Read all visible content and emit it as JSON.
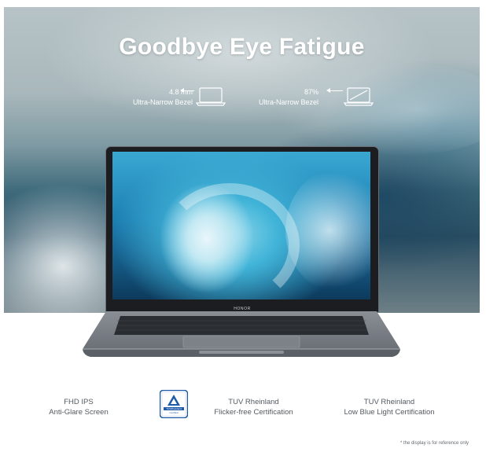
{
  "banner": {
    "title": "Goodbye Eye Fatigue",
    "specs": [
      {
        "value": "4.8 mm",
        "label": "Ultra-Narrow Bezel"
      },
      {
        "value": "87%",
        "label": "Ultra-Narrow Bezel"
      }
    ]
  },
  "laptop": {
    "brand": "HONOR"
  },
  "features": [
    {
      "line1": "FHD IPS",
      "line2": "Anti-Glare Screen"
    },
    {
      "line1": "TUV Rheinland",
      "line2": "Flicker-free Certification"
    },
    {
      "line1": "TUV Rheinland",
      "line2": "Low Blue Light Certification"
    }
  ],
  "badge": {
    "icon": "tuv-certification-icon",
    "text_top": "TÜVRheinland",
    "text_bottom": "Certified"
  },
  "disclaimer": "* the display is for reference only",
  "colors": {
    "title": "#ffffff",
    "feature_text": "#555a60",
    "badge_blue": "#1f5aa8"
  }
}
